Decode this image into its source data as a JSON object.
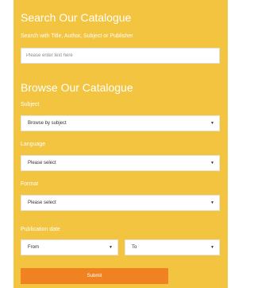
{
  "search": {
    "title": "Search Our Catalogue",
    "label": "Search with Title, Author, Subject or Publisher",
    "placeholder": "Please enter text here"
  },
  "browse": {
    "title": "Browse Our Catalogue",
    "subject": {
      "label": "Subject",
      "value": "Browse by subject"
    },
    "language": {
      "label": "Language",
      "value": "Please select"
    },
    "format": {
      "label": "Format",
      "value": "Please select"
    },
    "publication_date": {
      "label": "Publication date",
      "from": "From",
      "to": "To"
    },
    "submit_label": "Submit"
  },
  "icons": {
    "dropdown": "caret-down-icon"
  },
  "colors": {
    "panel_background": "#f2c43f",
    "submit_button": "#f08222",
    "text_on_panel": "#ffffff"
  }
}
